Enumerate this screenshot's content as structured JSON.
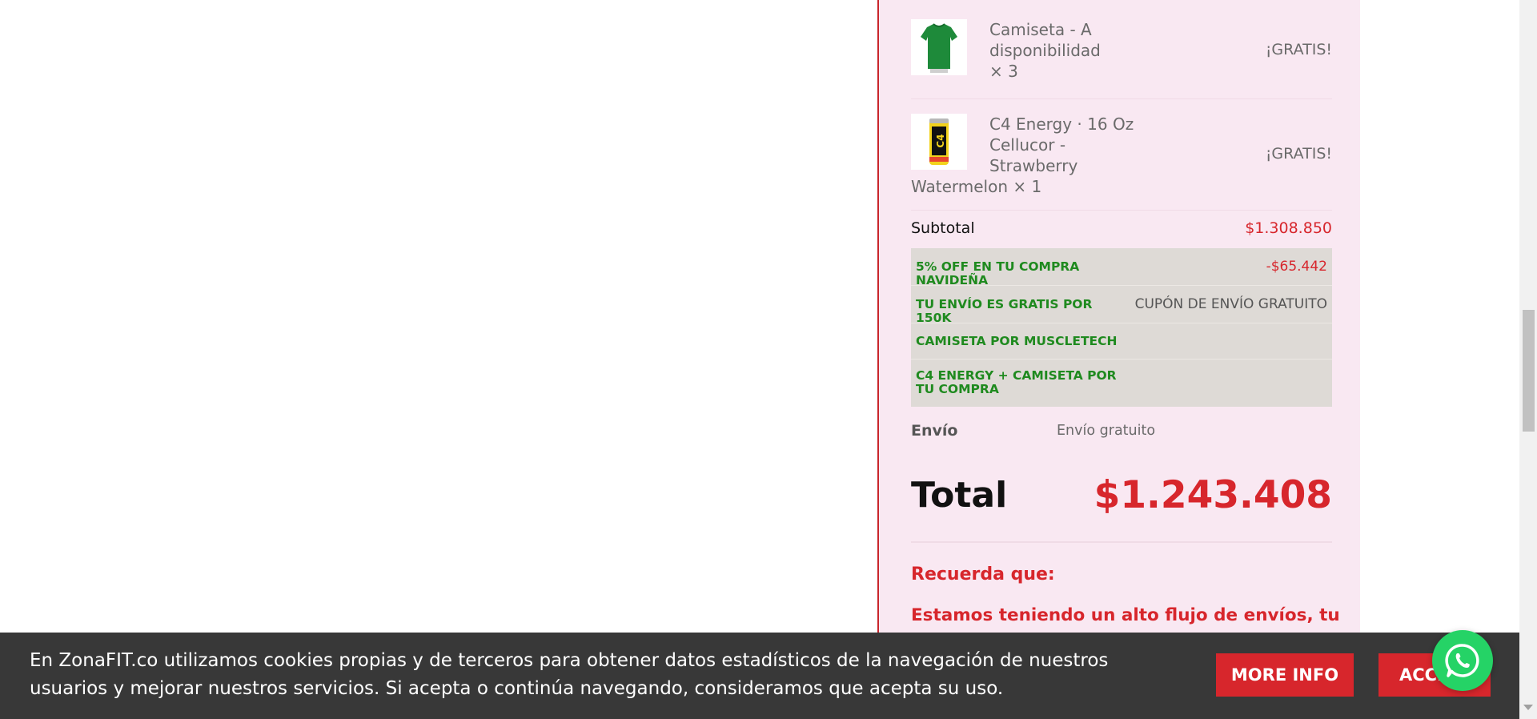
{
  "order": {
    "items": [
      {
        "name_lines": [
          "Camiseta - A",
          "disponibilidad",
          "× 3"
        ],
        "price": "¡GRATIS!",
        "thumb_icon": "green-tshirt-image"
      },
      {
        "name_lines": [
          "C4 Energy · 16 Oz",
          "Cellucor -",
          "Strawberry",
          "Watermelon  × 1"
        ],
        "price": "¡GRATIS!",
        "thumb_icon": "c4-energy-can-image"
      }
    ],
    "subtotal_label": "Subtotal",
    "subtotal_value": "$1.308.850",
    "coupons": [
      {
        "name": "5% OFF EN TU COMPRA NAVIDEÑA",
        "value": "-$65.442",
        "value_color": "#d7262c"
      },
      {
        "name": "TU ENVÍO ES GRATIS POR 150K",
        "value": "CUPÓN DE ENVÍO GRATUITO",
        "value_color": "#555555"
      },
      {
        "name": "CAMISETA POR MUSCLETECH",
        "value": ""
      },
      {
        "name": "C4 ENERGY + CAMISETA POR TU COMPRA",
        "value": ""
      }
    ],
    "shipping_label": "Envío",
    "shipping_value": "Envío gratuito",
    "total_label": "Total",
    "total_value": "$1.243.408",
    "notice_title": "Recuerda que:",
    "notice_text": "Estamos teniendo un alto flujo de envíos, tu"
  },
  "cookie": {
    "text": "En ZonaFIT.co utilizamos cookies propias y de terceros para obtener datos estadísticos de la navegación de nuestros usuarios y mejorar nuestros servicios. Si acepta o continúa navegando, consideramos que acepta su uso.",
    "more_info": "MORE INFO",
    "accept": "ACCEPT"
  },
  "colors": {
    "accent_red": "#d7262c",
    "panel_pink": "#f9e8f2",
    "coupon_green": "#1f8a1f",
    "cookie_bg": "#383838",
    "whatsapp_green": "#25d366"
  },
  "icons": {
    "whatsapp": "whatsapp-icon"
  }
}
